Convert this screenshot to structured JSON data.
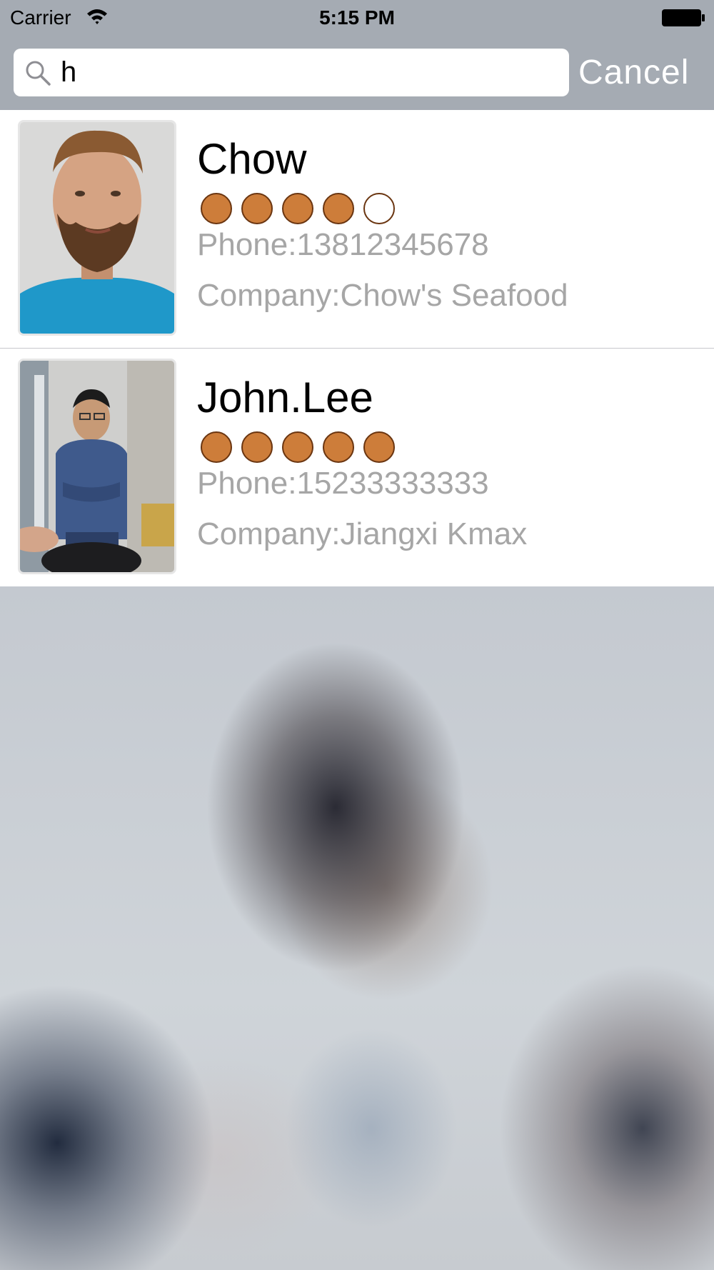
{
  "status_bar": {
    "carrier": "Carrier",
    "time": "5:15 PM",
    "wifi_icon": "wifi-icon",
    "battery_icon": "battery-full-icon"
  },
  "search": {
    "query": "h",
    "icon": "search-icon",
    "cancel_label": "Cancel"
  },
  "colors": {
    "rating_filled": "#cd7d3a",
    "rating_outline": "#6a3510",
    "secondary_text": "#a6a6a6",
    "header_background": "#a5abb3"
  },
  "results": [
    {
      "name": "Chow",
      "rating": 4,
      "rating_max": 5,
      "phone": "Phone:13812345678",
      "company": "Company:Chow's Seafood"
    },
    {
      "name": "John.Lee",
      "rating": 5,
      "rating_max": 5,
      "phone": "Phone:15233333333",
      "company": "Company:Jiangxi Kmax"
    }
  ]
}
